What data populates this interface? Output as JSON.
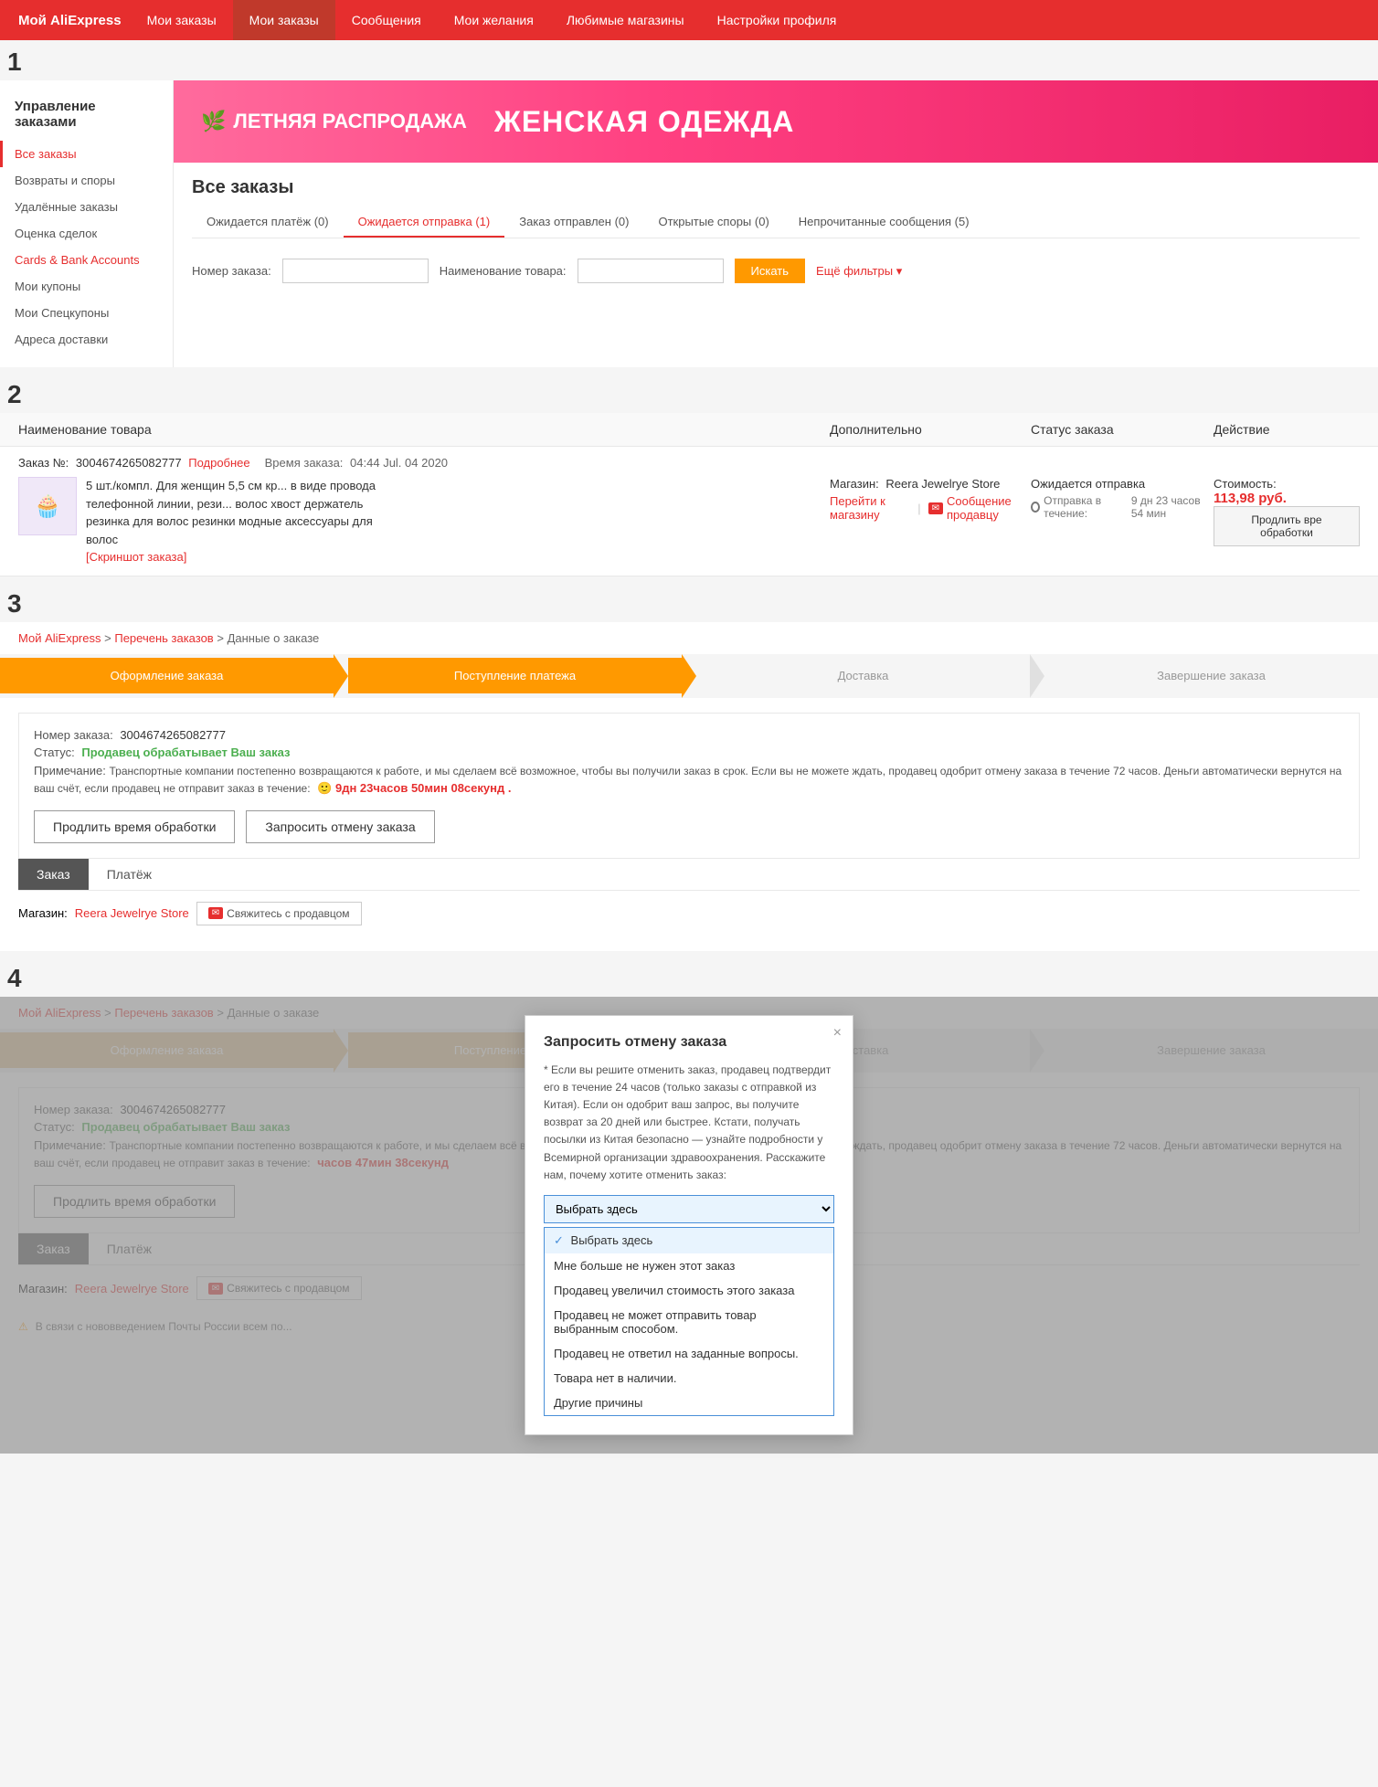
{
  "nav": {
    "logo": "Мой AliExpress",
    "items": [
      {
        "label": "Мои заказы",
        "active": true
      },
      {
        "label": "Сообщения"
      },
      {
        "label": "Мои желания"
      },
      {
        "label": "Любимые магазины"
      },
      {
        "label": "Настройки профиля"
      }
    ]
  },
  "sidebar": {
    "title": "Управление заказами",
    "items": [
      {
        "label": "Все заказы",
        "active": true
      },
      {
        "label": "Возвраты и споры"
      },
      {
        "label": "Удалённые заказы"
      },
      {
        "label": "Оценка сделок"
      },
      {
        "label": "Cards & Bank Accounts"
      },
      {
        "label": "Мои купоны"
      },
      {
        "label": "Мои Спецкупоны"
      },
      {
        "label": "Адреса доставки"
      }
    ]
  },
  "banner": {
    "left_icon": "🌿",
    "left_text": "ЛЕТНЯЯ РАСПРОДАЖА",
    "right_text": "ЖЕНСКАЯ ОДЕЖДА"
  },
  "orders_page": {
    "title": "Все заказы",
    "tabs": [
      {
        "label": "Ожидается платёж (0)"
      },
      {
        "label": "Ожидается отправка (1)",
        "active": true
      },
      {
        "label": "Заказ отправлен (0)"
      },
      {
        "label": "Открытые споры (0)"
      },
      {
        "label": "Непрочитанные сообщения (5)"
      }
    ],
    "filter": {
      "order_num_label": "Номер заказа:",
      "product_name_label": "Наименование товара:",
      "search_btn": "Искать",
      "more_filters": "Ещё фильтры"
    }
  },
  "table": {
    "headers": {
      "product": "Наименование товара",
      "extra": "Дополнительно",
      "status": "Статус заказа",
      "action": "Действие"
    },
    "order": {
      "num_label": "Заказ №:",
      "num_val": "3004674265082777",
      "detail_link": "Подробнее",
      "time_label": "Время заказа:",
      "time_val": "04:44 Jul. 04 2020",
      "product_desc": "5 шт./компл. Для женщин 5,5 см кр... в виде провода телефонной линии, рези... волос хвост держатель резинка для волос резинки модные аксессуары для волос",
      "screenshot": "[Скриншот заказа]",
      "store_label": "Магазин:",
      "store_name": "Reera Jewelrye Store",
      "store_link": "Перейти к магазину",
      "msg_seller": "Сообщение продавцу",
      "status_text": "Ожидается отправка",
      "shipping_label": "Отправка в течение:",
      "shipping_time": "9 дн 23 часов 54 мин",
      "price_label": "Стоимость:",
      "price_val": "113,98 руб.",
      "action_btn": "Продлить вре обработки"
    }
  },
  "section3": {
    "breadcrumb": [
      "Мой AliExpress",
      "Перечень заказов",
      "Данные о заказе"
    ],
    "progress_steps": [
      {
        "label": "Оформление заказа",
        "state": "done"
      },
      {
        "label": "Поступление платежа",
        "state": "active"
      },
      {
        "label": "Доставка",
        "state": "inactive"
      },
      {
        "label": "Завершение заказа",
        "state": "inactive"
      }
    ],
    "order_num_label": "Номер заказа:",
    "order_num_val": "3004674265082777",
    "status_label": "Статус:",
    "status_val": "Продавец обрабатывает Ваш заказ",
    "note_label": "Примечание:",
    "note_text": "Транспортные компании постепенно возвращаются к работе, и мы сделаем всё возможное, чтобы вы получили заказ в срок. Если вы не можете ждать, продавец одобрит отмену заказа в течение 72 часов. Деньги автоматически вернутся на ваш счёт, если продавец не отправит заказ в течение:",
    "timer": "🙂 9дн 23часов 50мин 08секунд .",
    "btn_extend": "Продлить время обработки",
    "btn_cancel": "Запросить отмену заказа",
    "tabs": [
      "Заказ",
      "Платёж"
    ],
    "active_tab": "Заказ",
    "store_label": "Магазин:",
    "store_name": "Reera Jewelrye Store",
    "contact_btn": "Свяжитесь с продавцом"
  },
  "section4": {
    "breadcrumb": [
      "Мой AliExpress",
      "Перечень заказов",
      "Данные о заказе"
    ],
    "progress_steps": [
      {
        "label": "Оформление заказа",
        "state": "done"
      },
      {
        "label": "Поступление платежа",
        "state": "active"
      },
      {
        "label": "Доставка",
        "state": "inactive"
      },
      {
        "label": "Завершение заказа",
        "state": "inactive"
      }
    ],
    "order_num_label": "Номер заказа:",
    "order_num_val": "3004674265082777",
    "status_label": "Статус:",
    "status_val": "Продавец обрабатывает Ваш заказ",
    "note_label": "Примечание:",
    "note_text": "Транспортные компании постепенно возвращаются к работе, и мы сделаем всё возможное, чтобы вы получили заказ в срок. Если вы не можете ждать, продавец одобрит отмену заказа в течение 72 часов. Деньги автоматически вернутся на ваш счёт, если продавец не отправит заказ в течение:",
    "timer": "часов 47мин 38секунд",
    "btn_extend": "Продлить время обработки",
    "tabs": [
      "Заказ",
      "Платёж"
    ],
    "store_name": "Reera Jewelrye Store",
    "contact_btn": "Свяжитесь с продавцом",
    "dialog": {
      "title": "Запросить отмену заказа",
      "close": "×",
      "note": "* Если вы решите отменить заказ, продавец подтвердит его в течение 24 часов (только заказы с отправкой из Китая). Если он одобрит ваш запрос, вы получите возврат за 20 дней или быстрее. Кстати, получать посылки из Китая безопасно — узнайте подробности у Всемирной организации здравоохранения. Расскажите нам, почему хотите отменить заказ:",
      "select_placeholder": "Выбрать здесь",
      "options": [
        {
          "label": "Выбрать здесь",
          "selected": true
        },
        {
          "label": "Мне больше не нужен этот заказ"
        },
        {
          "label": "Продавец увеличил стоимость этого заказа"
        },
        {
          "label": "Продавец не может отправить товар выбранным способом."
        },
        {
          "label": "Продавец не ответил на заданные вопросы."
        },
        {
          "label": "Товара нет в наличии."
        },
        {
          "label": "Другие причины"
        }
      ]
    }
  }
}
